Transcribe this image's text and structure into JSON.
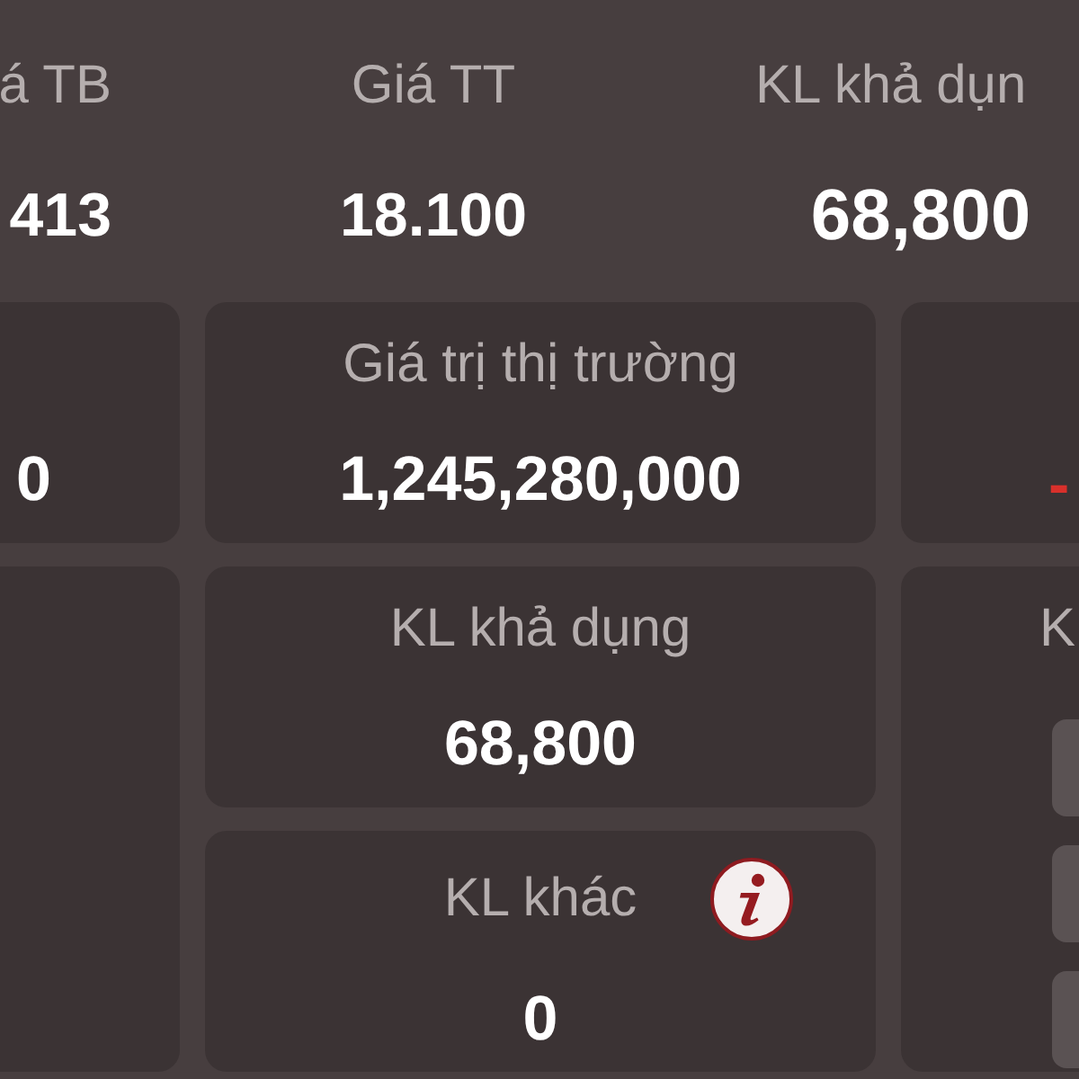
{
  "summary_header": {
    "columns": [
      {
        "label": "á TB",
        "value": "413"
      },
      {
        "label": "Giá TT",
        "value": "18.100"
      },
      {
        "label": "KL khả dụn",
        "value": "68,800"
      }
    ]
  },
  "card_columns": [
    {
      "cards": [
        {
          "kind": "stat",
          "value": "0",
          "negative": false
        },
        {
          "kind": "blank"
        }
      ]
    },
    {
      "cards": [
        {
          "kind": "stat",
          "label": "Giá trị thị trường",
          "value": "1,245,280,000",
          "negative": false
        },
        {
          "kind": "stat",
          "label": "KL khả dụng",
          "value": "68,800",
          "negative": false
        },
        {
          "kind": "stat",
          "label": "KL khác",
          "value": "0",
          "negative": false,
          "info": true
        }
      ]
    },
    {
      "cards": [
        {
          "kind": "stat",
          "value": "-",
          "negative": true
        },
        {
          "kind": "options",
          "label": "K"
        }
      ]
    }
  ]
}
